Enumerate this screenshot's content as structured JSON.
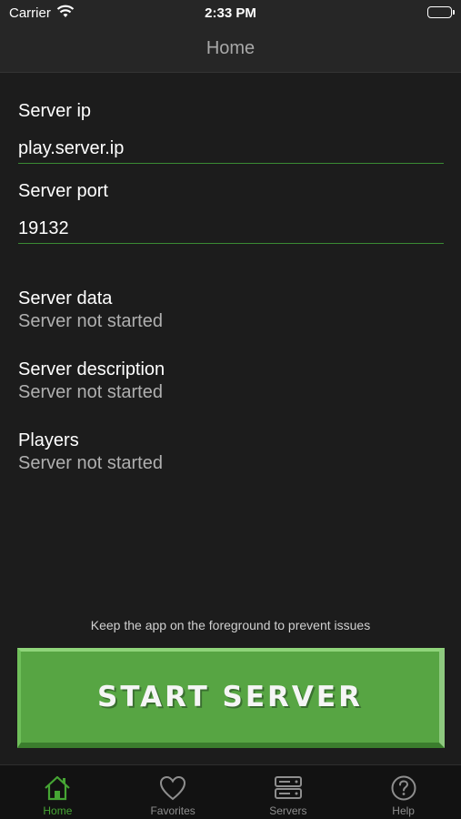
{
  "status_bar": {
    "carrier": "Carrier",
    "time": "2:33 PM"
  },
  "nav": {
    "title": "Home"
  },
  "form": {
    "server_ip_label": "Server ip",
    "server_ip_value": "play.server.ip",
    "server_port_label": "Server port",
    "server_port_value": "19132"
  },
  "info": [
    {
      "label": "Server data",
      "value": "Server not started"
    },
    {
      "label": "Server description",
      "value": "Server not started"
    },
    {
      "label": "Players",
      "value": "Server not started"
    }
  ],
  "hint": "Keep the app on the foreground to prevent issues",
  "start_button": {
    "label": "START SERVER"
  },
  "tabs": [
    {
      "label": "Home",
      "icon": "home-icon",
      "active": true
    },
    {
      "label": "Favorites",
      "icon": "heart-icon",
      "active": false
    },
    {
      "label": "Servers",
      "icon": "servers-icon",
      "active": false
    },
    {
      "label": "Help",
      "icon": "help-icon",
      "active": false
    }
  ],
  "colors": {
    "accent": "#46a534",
    "button": "#57a543",
    "background": "#1c1c1c"
  }
}
